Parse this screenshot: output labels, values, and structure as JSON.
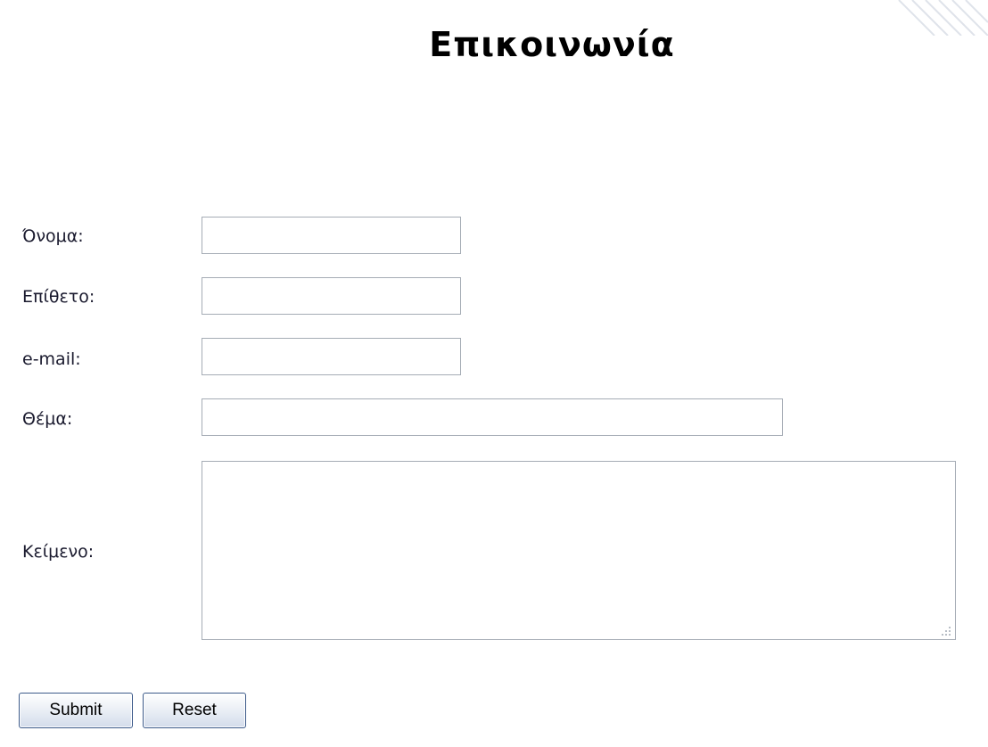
{
  "page": {
    "title": "Επικοινωνία"
  },
  "form": {
    "first_name_label": "Όνομα:",
    "first_name_value": "",
    "last_name_label": "Επίθετο:",
    "last_name_value": "",
    "email_label": "e-mail:",
    "email_value": "",
    "subject_label": "Θέμα:",
    "subject_value": "",
    "message_label": "Κείμενο:",
    "message_value": "",
    "submit_label": "Submit",
    "reset_label": "Reset"
  },
  "colors": {
    "input_border": "#a5acb5",
    "button_border": "#3c5a8a",
    "label_text": "#1a1a2e"
  },
  "icons": {
    "textarea_grip": "resize-grip-icon",
    "corner": "decorative-stripes"
  }
}
